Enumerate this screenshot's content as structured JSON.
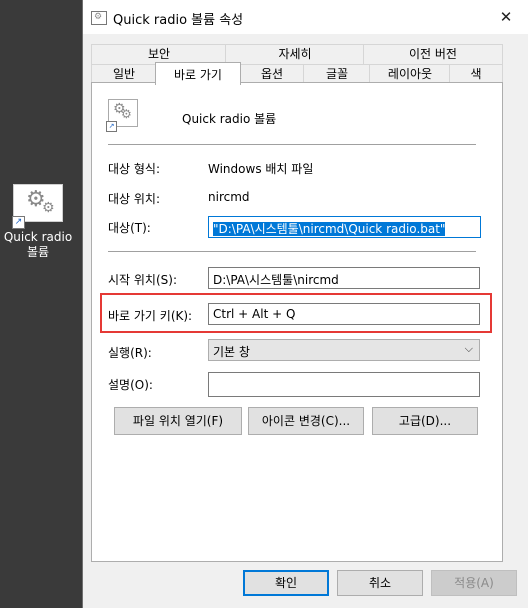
{
  "desktop": {
    "icon_label": "Quick radio\n볼륨",
    "icon": "gears-shortcut-icon"
  },
  "dialog": {
    "title": "Quick radio 볼륨 속성",
    "close_glyph": "✕",
    "tabs_back": [
      "보안",
      "자세히",
      "이전 버전"
    ],
    "tabs_front": [
      "일반",
      "바로 가기",
      "옵션",
      "글꼴",
      "레이아웃",
      "색"
    ],
    "active_tab": "바로 가기",
    "file_name": "Quick radio 볼륨",
    "target_type_label": "대상 형식:",
    "target_type_value": "Windows 배치 파일",
    "target_location_label": "대상 위치:",
    "target_location_value": "nircmd",
    "target_label": "대상(T):",
    "target_value": "\"D:\\PA\\시스템툴\\nircmd\\Quick radio.bat\"",
    "start_in_label": "시작 위치(S):",
    "start_in_value": "D:\\PA\\시스템툴\\nircmd",
    "shortcut_key_label": "바로 가기 키(K):",
    "shortcut_key_value": "Ctrl + Alt + Q",
    "run_label": "실행(R):",
    "run_value": "기본 창",
    "comment_label": "설명(O):",
    "comment_value": "",
    "open_location_button": "파일 위치 열기(F)",
    "change_icon_button": "아이콘 변경(C)...",
    "advanced_button": "고급(D)...",
    "ok_button": "확인",
    "cancel_button": "취소",
    "apply_button": "적용(A)"
  },
  "colors": {
    "accent": "#0078d7",
    "highlight_box": "#e53935"
  }
}
